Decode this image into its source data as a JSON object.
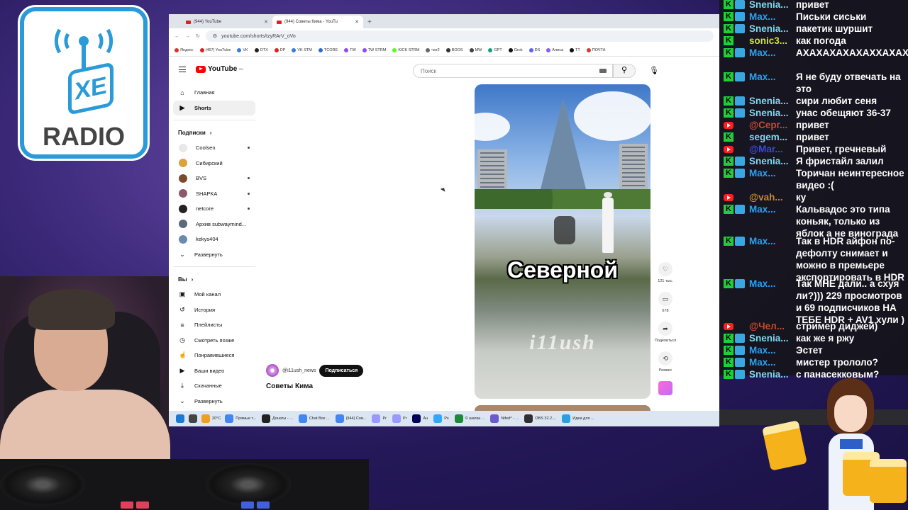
{
  "logo": {
    "text": "RADIO",
    "mark": "XE"
  },
  "browser": {
    "tabs": [
      {
        "label": "(944) YouTube"
      },
      {
        "label": "(944) Советы Кима - YouTu"
      }
    ],
    "url": "youtube.com/shorts/tzyRArV_oVo",
    "bookmarks": [
      "Яндекс",
      "(467) YouTube",
      "VK",
      "DTX",
      "DP",
      "VK STM",
      "TCORE",
      "TW",
      "TW STRM",
      "KICK STRM",
      "чат2",
      "BOOS",
      "MW",
      "GPT",
      "Grok",
      "DS",
      "Алиса",
      "TT",
      "ПОЧТА"
    ]
  },
  "youtube": {
    "logo": "YouTube",
    "logo_sup": "RU",
    "search_placeholder": "Поиск",
    "nav": [
      {
        "label": "Главная",
        "icon": "home-icon",
        "glyph": "⌂"
      },
      {
        "label": "Shorts",
        "icon": "shorts-icon",
        "glyph": "▶"
      }
    ],
    "subs_header": "Подписки",
    "subs": [
      {
        "label": "Coolsen",
        "color": "#e8e8e8",
        "dot": true
      },
      {
        "label": "Сибирский",
        "color": "#d9a23a",
        "dot": false
      },
      {
        "label": "BVS",
        "color": "#7a4a2a",
        "dot": true
      },
      {
        "label": "SHAPKA",
        "color": "#8a5a6a",
        "dot": true
      },
      {
        "label": "netcore",
        "color": "#222222",
        "dot": true
      },
      {
        "label": "Архив subwaymind...",
        "color": "#5a6a7a",
        "dot": false
      },
      {
        "label": "kekys404",
        "color": "#6a8ab0",
        "dot": false
      }
    ],
    "expand1": "Развернуть",
    "you_header": "Вы",
    "you_items": [
      {
        "label": "Мой канал",
        "icon": "channel-icon",
        "glyph": "▣"
      },
      {
        "label": "История",
        "icon": "history-icon",
        "glyph": "↺"
      },
      {
        "label": "Плейлисты",
        "icon": "playlist-icon",
        "glyph": "≡"
      },
      {
        "label": "Смотреть позже",
        "icon": "clock-icon",
        "glyph": "◷"
      },
      {
        "label": "Понравившиеся",
        "icon": "like-icon",
        "glyph": "☝"
      },
      {
        "label": "Ваши видео",
        "icon": "video-icon",
        "glyph": "▶"
      },
      {
        "label": "Скачанные",
        "icon": "download-icon",
        "glyph": "⤓"
      }
    ],
    "expand2": "Развернуть",
    "short": {
      "caption": "Северной",
      "watermark": "i11ush",
      "likes": "121 тыс.",
      "comments": "678",
      "share": "Поделиться",
      "remix": "Ремикс",
      "channel": "@i11ush_news",
      "subscribe": "Подписаться",
      "title": "Советы Кима"
    }
  },
  "taskbar": {
    "weather": "20°C",
    "items": [
      "Прямые т...",
      "Донаты - ...",
      "Chat Box ...",
      "(944) Сов...",
      "Pr",
      "Pr",
      "Au",
      "Ps",
      "© шапка ...",
      "Nifed^ - ...",
      "OBS 32.2....",
      "Идеи для ..."
    ]
  },
  "chat": [
    {
      "nick": "Snenia...",
      "text": "привет",
      "nick_color": "#7fd8f0",
      "badges": [
        "k",
        "a"
      ]
    },
    {
      "nick": "Max...",
      "text": "Письки сиськи",
      "nick_color": "#2aa0f0",
      "badges": [
        "k",
        "a"
      ]
    },
    {
      "nick": "Snenia...",
      "text": "пакетик шуршит",
      "nick_color": "#7fd8f0",
      "badges": [
        "k",
        "a"
      ]
    },
    {
      "nick": "sonic3...",
      "text": "как погода",
      "nick_color": "#cfe33a",
      "badges": [
        "k"
      ]
    },
    {
      "nick": "Max...",
      "text": "АХАХАХАХАХАХХАХАХА",
      "nick_color": "#2aa0f0",
      "badges": [
        "k",
        "a"
      ]
    },
    {
      "nick": "Max...",
      "text": "Я не буду отвечать на это",
      "nick_color": "#2aa0f0",
      "badges": [
        "k",
        "a"
      ]
    },
    {
      "nick": "Snenia...",
      "text": "сири любит сеня",
      "nick_color": "#7fd8f0",
      "badges": [
        "k",
        "a"
      ]
    },
    {
      "nick": "Snenia...",
      "text": "унас обещяют 36-37",
      "nick_color": "#7fd8f0",
      "badges": [
        "k",
        "a"
      ]
    },
    {
      "nick": "@Серг...",
      "text": "привет",
      "nick_color": "#c84a2a",
      "badges": [
        "y"
      ]
    },
    {
      "nick": "segem...",
      "text": "привет",
      "nick_color": "#7fd8f0",
      "badges": [
        "k"
      ]
    },
    {
      "nick": "@Mar...",
      "text": "Привет, гречневый",
      "nick_color": "#3a4ad8",
      "badges": [
        "y"
      ]
    },
    {
      "nick": "Snenia...",
      "text": "Я фристайл залил",
      "nick_color": "#7fd8f0",
      "badges": [
        "k",
        "a"
      ]
    },
    {
      "nick": "Max...",
      "text": "Торичан неинтересное видео :(",
      "nick_color": "#2aa0f0",
      "badges": [
        "k",
        "a"
      ]
    },
    {
      "nick": "@vah...",
      "text": "ку",
      "nick_color": "#c8882a",
      "badges": [
        "y"
      ]
    },
    {
      "nick": "Max...",
      "text": "Кальвадос это типа коньяк, только из яблок а не винограда",
      "nick_color": "#2aa0f0",
      "badges": [
        "k",
        "a"
      ]
    },
    {
      "nick": "Max...",
      "text": "Так в HDR айфон по-дефолту снимает и можно в премьере экспортировать в HDR",
      "nick_color": "#2aa0f0",
      "badges": [
        "k",
        "a"
      ]
    },
    {
      "nick": "Max...",
      "text": "Так МНЕ дали.. а схуя ли?))) 229 просмотров и 69 подписчиков НА ТЕБЕ HDR + AV1 хули )",
      "nick_color": "#2aa0f0",
      "badges": [
        "k",
        "a"
      ]
    },
    {
      "nick": "@Чел...",
      "text": "стример диджей)",
      "nick_color": "#c84a2a",
      "badges": [
        "y"
      ]
    },
    {
      "nick": "Snenia...",
      "text": "как же я ржу",
      "nick_color": "#7fd8f0",
      "badges": [
        "k",
        "a"
      ]
    },
    {
      "nick": "Max...",
      "text": "Эстет",
      "nick_color": "#2aa0f0",
      "badges": [
        "k",
        "a"
      ]
    },
    {
      "nick": "Max...",
      "text": "мистер трололо?",
      "nick_color": "#2aa0f0",
      "badges": [
        "k",
        "a"
      ]
    },
    {
      "nick": "Snenia...",
      "text": "с панасекковым?",
      "nick_color": "#7fd8f0",
      "badges": [
        "k",
        "a"
      ]
    }
  ]
}
